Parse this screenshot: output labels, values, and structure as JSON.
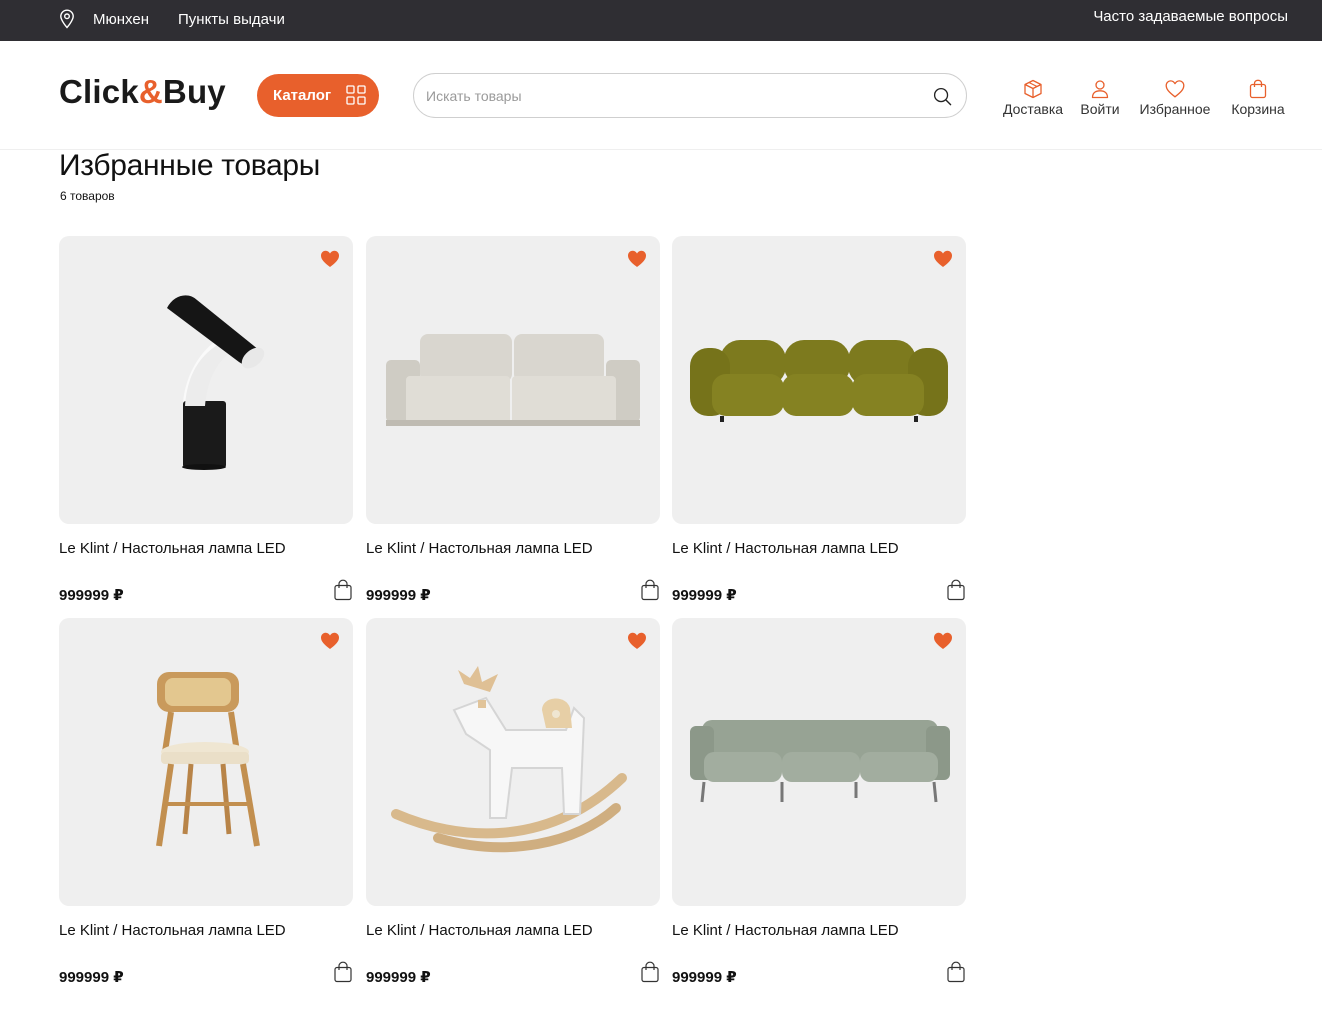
{
  "topbar": {
    "city": "Мюнхен",
    "pickup_points": "Пункты выдачи",
    "faq": "Часто задаваемые вопросы",
    "location_icon": "map-pin-icon"
  },
  "header": {
    "logo_left": "Click",
    "logo_amp": "&",
    "logo_right": "Buy",
    "catalog_label": "Каталог",
    "search_placeholder": "Искать товары",
    "nav": {
      "delivery": "Доставка",
      "login": "Войти",
      "favorites": "Избранное",
      "cart": "Корзина"
    }
  },
  "page": {
    "title": "Избранные товары",
    "count": "6 товаров"
  },
  "colors": {
    "accent": "#e8602c",
    "topbar_bg": "#2f2e33",
    "card_bg": "#efefef"
  },
  "products": [
    {
      "title": "Le Klint / Настольная лампа LED",
      "price": "999999 ₽",
      "image": "table-lamp",
      "favorite": true
    },
    {
      "title": "Le Klint / Настольная лампа LED",
      "price": "999999 ₽",
      "image": "beige-sofa",
      "favorite": true
    },
    {
      "title": "Le Klint / Настольная лампа LED",
      "price": "999999 ₽",
      "image": "olive-sofa",
      "favorite": true
    },
    {
      "title": "Le Klint / Настольная лампа LED",
      "price": "999999 ₽",
      "image": "wooden-chair",
      "favorite": true
    },
    {
      "title": "Le Klint / Настольная лампа LED",
      "price": "999999 ₽",
      "image": "rocking-horse",
      "favorite": true
    },
    {
      "title": "Le Klint / Настольная лампа LED",
      "price": "999999 ₽",
      "image": "green-sofa",
      "favorite": true
    }
  ]
}
